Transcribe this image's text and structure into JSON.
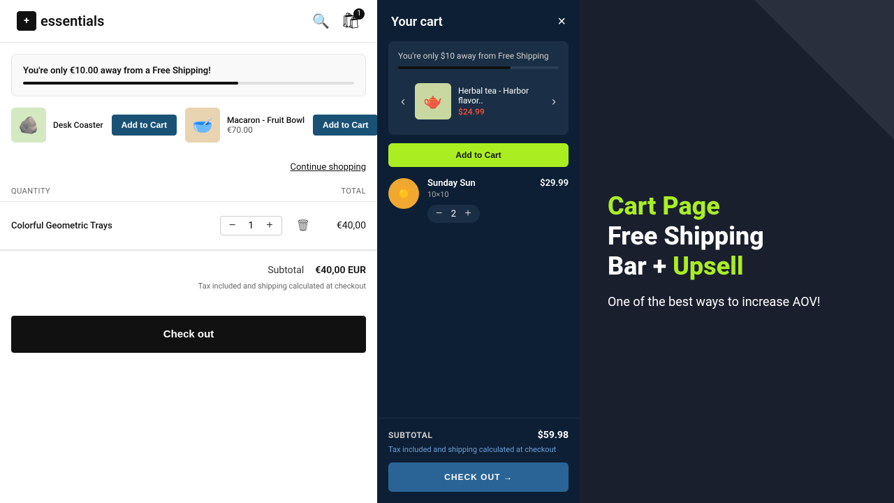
{
  "store": {
    "logo_text": "essentials",
    "logo_icon": "+",
    "cart_count": "1",
    "shipping_banner": {
      "text": "You're only €10.00 away from a Free Shipping!",
      "progress": 65
    },
    "upsell_items": [
      {
        "name": "Desk Coaster",
        "emoji": "🪨",
        "bg": "#d4e8c2",
        "add_label": "Add to Cart"
      },
      {
        "name": "Macaron - Fruit Bowl",
        "price": "€70.00",
        "emoji": "🍚",
        "bg": "#e8d4b0",
        "add_label": "Add to Cart"
      }
    ],
    "continue_shopping": "Continue shopping",
    "table_headers": {
      "quantity": "QUANTITY",
      "total": "TOTAL"
    },
    "cart_item": {
      "name": "Colorful Geometric Trays",
      "quantity": "1",
      "price": "€40,00"
    },
    "subtotal_label": "Subtotal",
    "subtotal_amount": "€40,00 EUR",
    "tax_note": "Tax included and shipping calculated at checkout",
    "checkout_label": "Check out"
  },
  "drawer": {
    "title": "Your cart",
    "close_label": "×",
    "shipping_bar": {
      "text": "You're only $10 away from Free Shipping",
      "progress": 70
    },
    "upsell": {
      "name": "Herbal tea - Harbor flavor..",
      "price": "$24.99",
      "emoji": "🫖",
      "bg": "#c8d8a0",
      "add_label": "Add to Cart",
      "prev_label": "‹",
      "next_label": "›"
    },
    "cart_item": {
      "name": "Sunday Sun",
      "variant": "10×10",
      "quantity": "2",
      "price": "$29.99",
      "emoji": "☀️",
      "bg": "#f0a830"
    },
    "subtotal_label": "SUBTOTAL",
    "subtotal_amount": "$59.98",
    "tax_note": "Tax included and shipping calculated at checkout",
    "checkout_label": "CHECK OUT →"
  },
  "promo": {
    "line1": "Cart Page",
    "line2": "Free Shipping",
    "line3_prefix": "Bar + ",
    "line3_highlight": "Upsell",
    "sub": "One of the best ways to increase AOV!"
  }
}
